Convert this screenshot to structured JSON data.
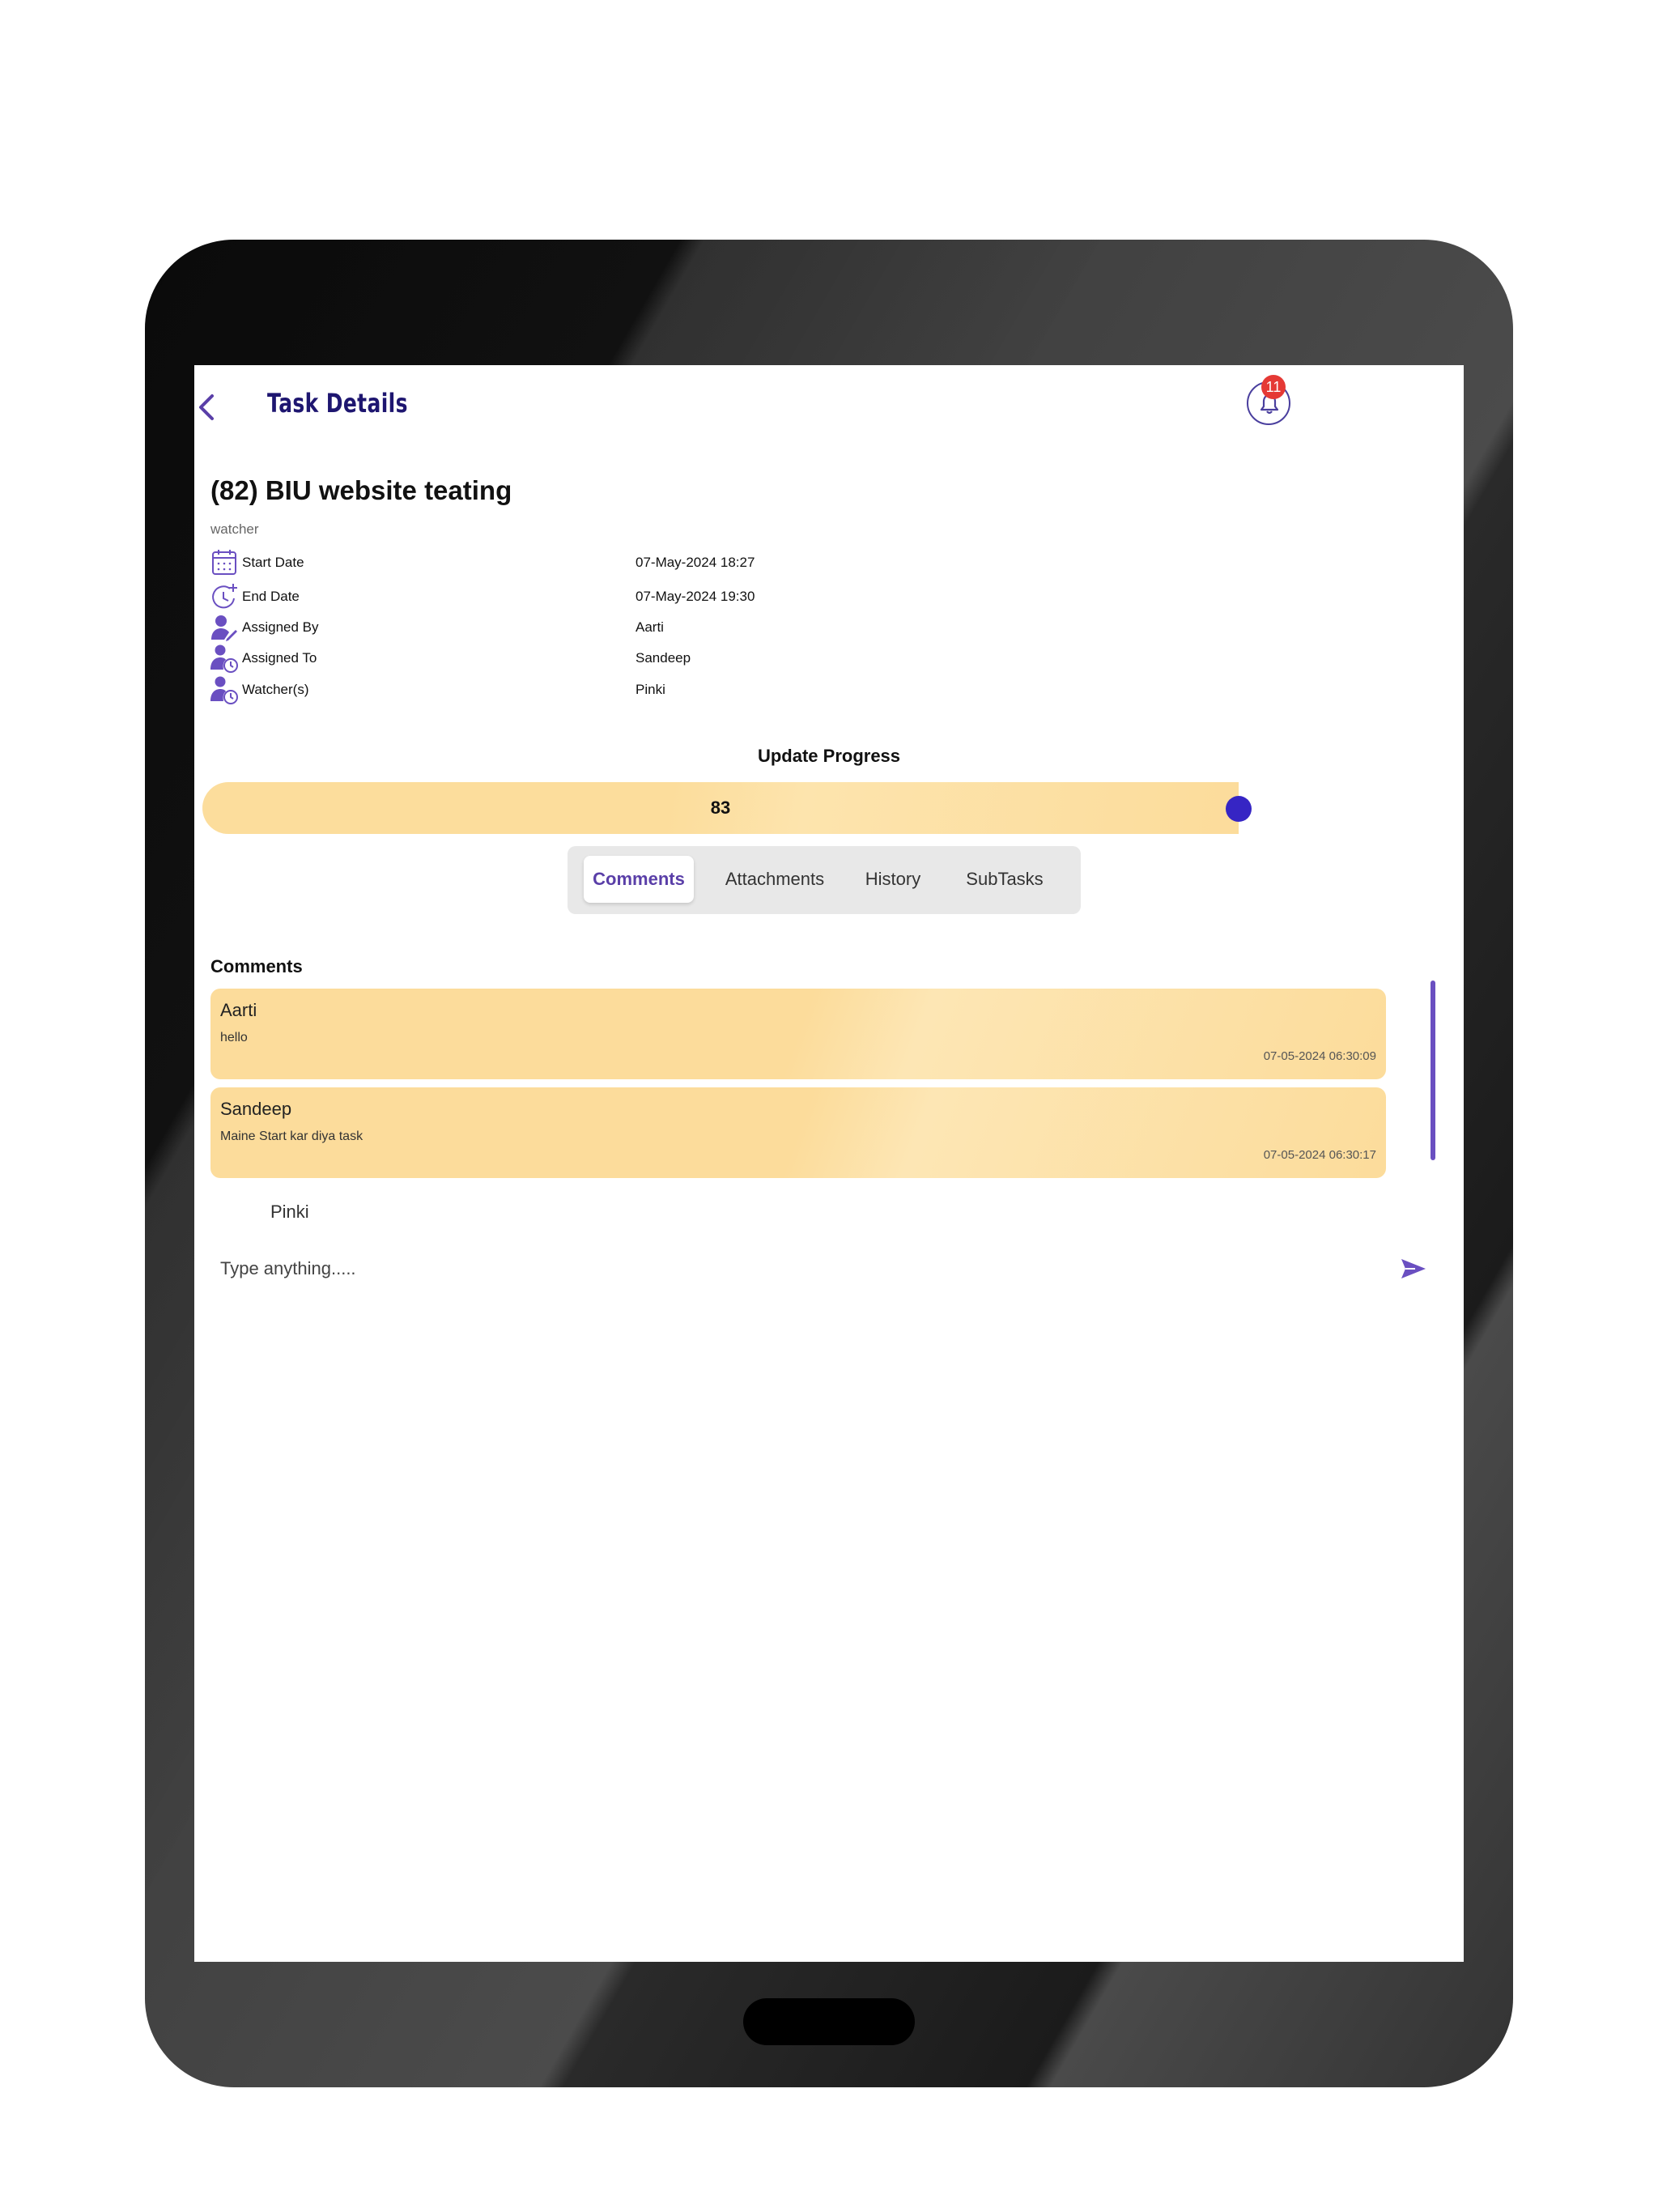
{
  "header": {
    "title": "Task Details",
    "notification_count": "11"
  },
  "task": {
    "title": "(82) BIU website teating",
    "role_tag": "watcher",
    "fields": [
      {
        "label": "Start Date",
        "value": "07-May-2024 18:27",
        "icon": "calendar-icon"
      },
      {
        "label": "End Date",
        "value": "07-May-2024 19:30",
        "icon": "clock-plus-icon"
      },
      {
        "label": "Assigned By",
        "value": "Aarti",
        "icon": "user-edit-icon"
      },
      {
        "label": "Assigned To",
        "value": "Sandeep",
        "icon": "user-clock-icon"
      },
      {
        "label": "Watcher(s)",
        "value": "Pinki",
        "icon": "user-clock-icon"
      }
    ]
  },
  "progress": {
    "label": "Update Progress",
    "value": "83",
    "fraction": 0.83
  },
  "tabs": [
    {
      "label": "Comments",
      "active": true
    },
    {
      "label": "Attachments",
      "active": false
    },
    {
      "label": "History",
      "active": false
    },
    {
      "label": "SubTasks",
      "active": false
    }
  ],
  "comments_section": {
    "title": "Comments",
    "items": [
      {
        "author": "Aarti",
        "text": "hello",
        "time": "07-05-2024 06:30:09"
      },
      {
        "author": "Sandeep",
        "text": "Maine Start kar diya task",
        "time": "07-05-2024 06:30:17"
      }
    ],
    "mention": "Pinki",
    "input_placeholder": "Type anything.....",
    "send_icon": "send-icon"
  },
  "colors": {
    "accent": "#5a3fa8",
    "title": "#1e1670",
    "card": "#fcdc9b",
    "thumb": "#3625c4",
    "badge": "#e53935"
  }
}
